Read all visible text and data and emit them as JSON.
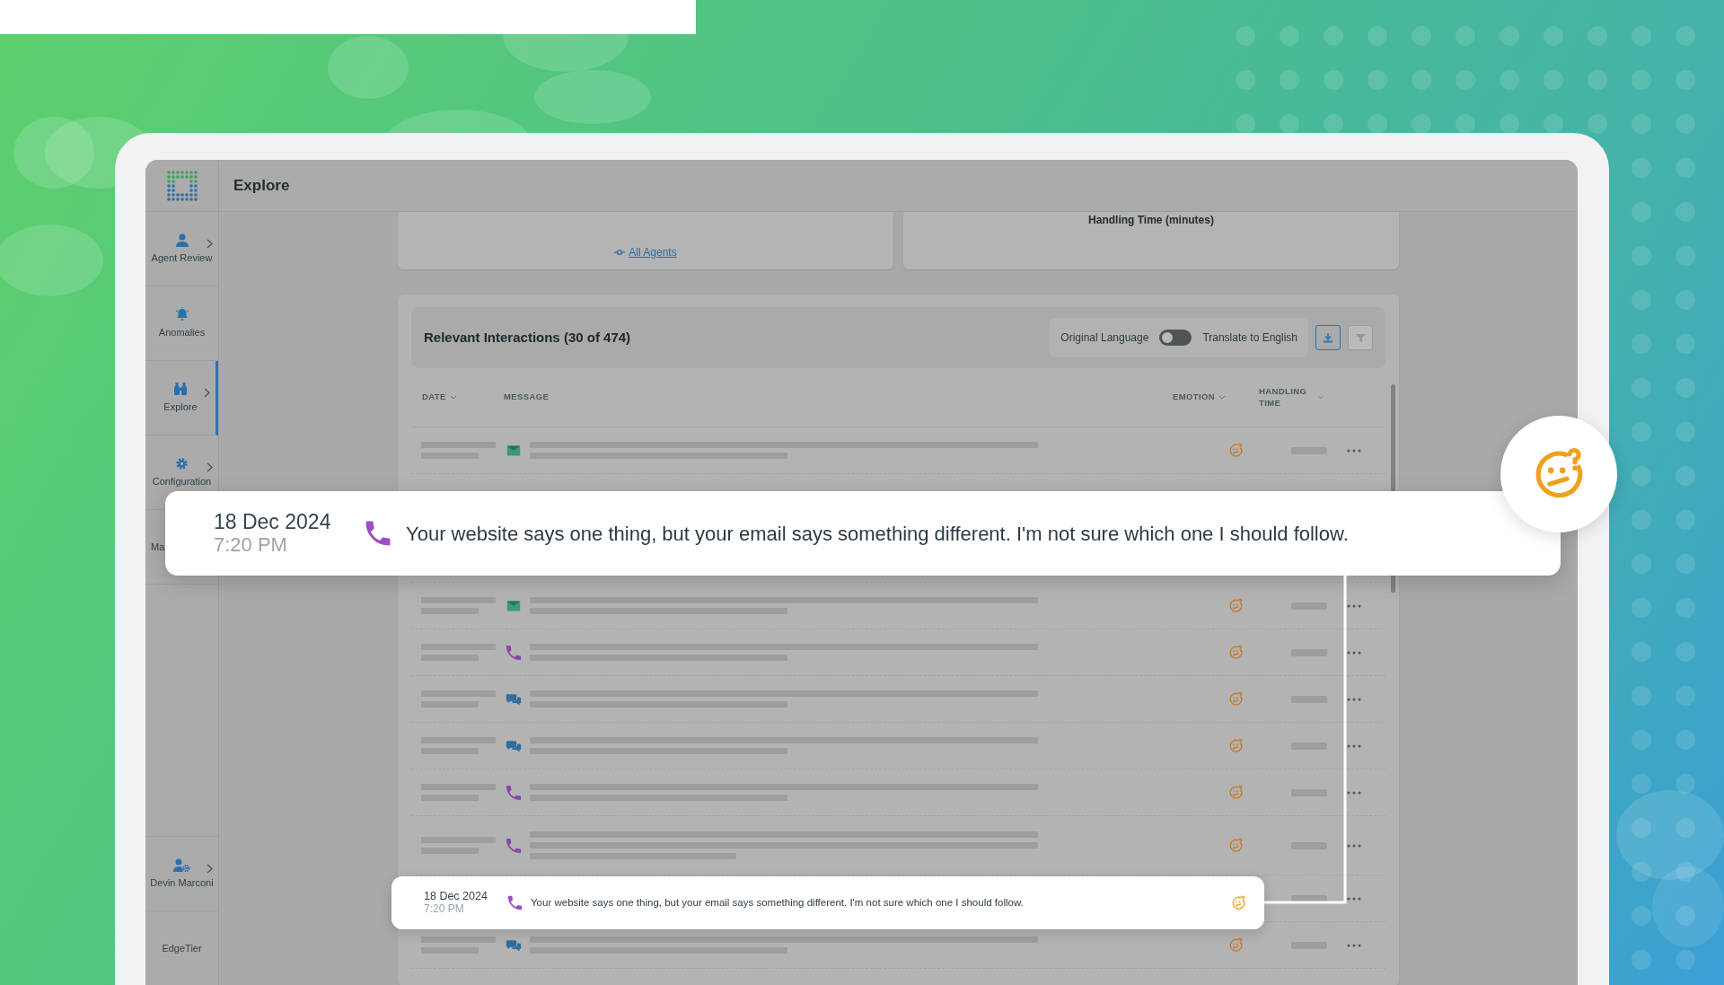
{
  "header": {
    "title": "Explore"
  },
  "sidebar": {
    "items": [
      {
        "kind": "nav",
        "label": "Agent Review",
        "submenu": true,
        "selected": false
      },
      {
        "kind": "nav",
        "label": "Anomalies",
        "submenu": false,
        "selected": false
      },
      {
        "kind": "nav",
        "label": "Explore",
        "submenu": true,
        "selected": true
      },
      {
        "kind": "nav",
        "label": "Configuration",
        "submenu": true,
        "selected": false
      },
      {
        "kind": "partial",
        "label": "Ma",
        "submenu": false,
        "selected": false
      }
    ],
    "bottom_items": [
      {
        "kind": "user",
        "label": "Devin Marconi",
        "submenu": true,
        "selected": false
      },
      {
        "kind": "text",
        "label": "EdgeTier",
        "submenu": false,
        "selected": false
      }
    ]
  },
  "summary_cards": [
    {
      "kind": "filter",
      "label": "All Agents"
    },
    {
      "kind": "chart_title",
      "label": "Handling Time (minutes)"
    }
  ],
  "interactions": {
    "title": "Relevant Interactions (30 of 474)",
    "language_toggle": {
      "left_label": "Original Language",
      "right_label": "Translate to English",
      "on": false
    },
    "actions": [
      {
        "kind": "download",
        "disabled": false
      },
      {
        "kind": "filter",
        "disabled": true
      }
    ],
    "columns": [
      {
        "label": "DATE",
        "sortable": true
      },
      {
        "label": "MESSAGE",
        "sortable": false
      },
      {
        "label": "EMOTION",
        "sortable": true
      },
      {
        "label": "HANDLING TIME",
        "sortable": true
      }
    ],
    "rows": [
      {
        "kind": "skeleton",
        "icon": {
          "kind": "email"
        }
      },
      {
        "kind": "gap"
      },
      {
        "kind": "skeleton",
        "icon": {
          "kind": "email"
        }
      },
      {
        "kind": "skeleton",
        "icon": {
          "kind": "phone"
        }
      },
      {
        "kind": "skeleton",
        "icon": {
          "kind": "chat"
        }
      },
      {
        "kind": "skeleton",
        "icon": {
          "kind": "chat"
        }
      },
      {
        "kind": "skeleton",
        "icon": {
          "kind": "phone"
        }
      },
      {
        "kind": "skeleton_long",
        "icon": {
          "kind": "phone"
        }
      },
      {
        "kind": "covered"
      },
      {
        "kind": "skeleton",
        "icon": {
          "kind": "chat"
        }
      }
    ]
  },
  "highlight_popup": {
    "date": "18 Dec 2024",
    "time": "7:20 PM",
    "icon": {
      "kind": "phone"
    },
    "message": "Your website says one thing, but your email says something different. I'm not sure which one I should follow."
  },
  "row_popup": {
    "date": "18 Dec 2024",
    "time": "7:20 PM",
    "icon": {
      "kind": "phone"
    },
    "message": "Your website says one thing, but your email says something different. I'm not sure which one I should follow."
  }
}
